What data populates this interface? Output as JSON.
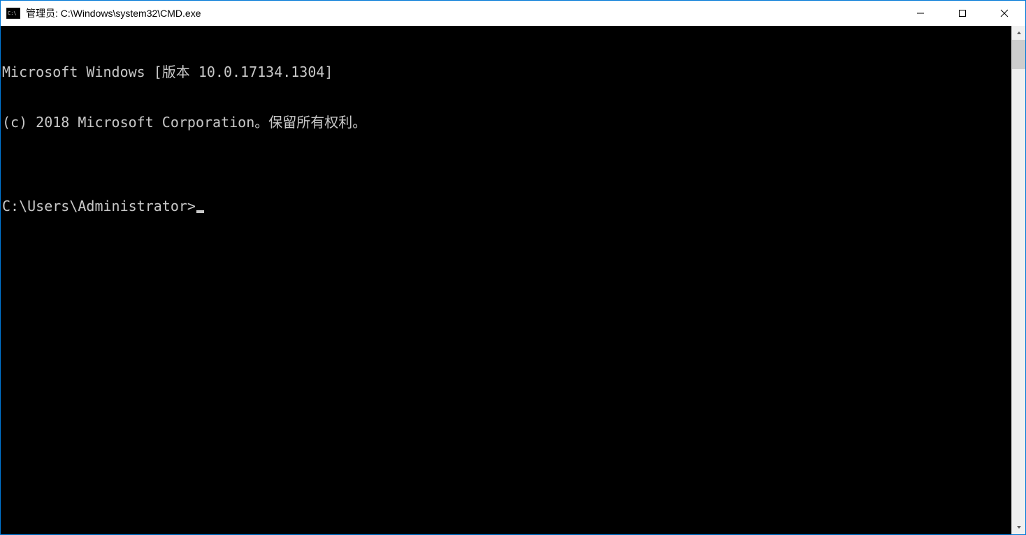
{
  "window": {
    "title": "管理员: C:\\Windows\\system32\\CMD.exe"
  },
  "terminal": {
    "lines": [
      "Microsoft Windows [版本 10.0.17134.1304]",
      "(c) 2018 Microsoft Corporation。保留所有权利。",
      ""
    ],
    "prompt": "C:\\Users\\Administrator>"
  }
}
